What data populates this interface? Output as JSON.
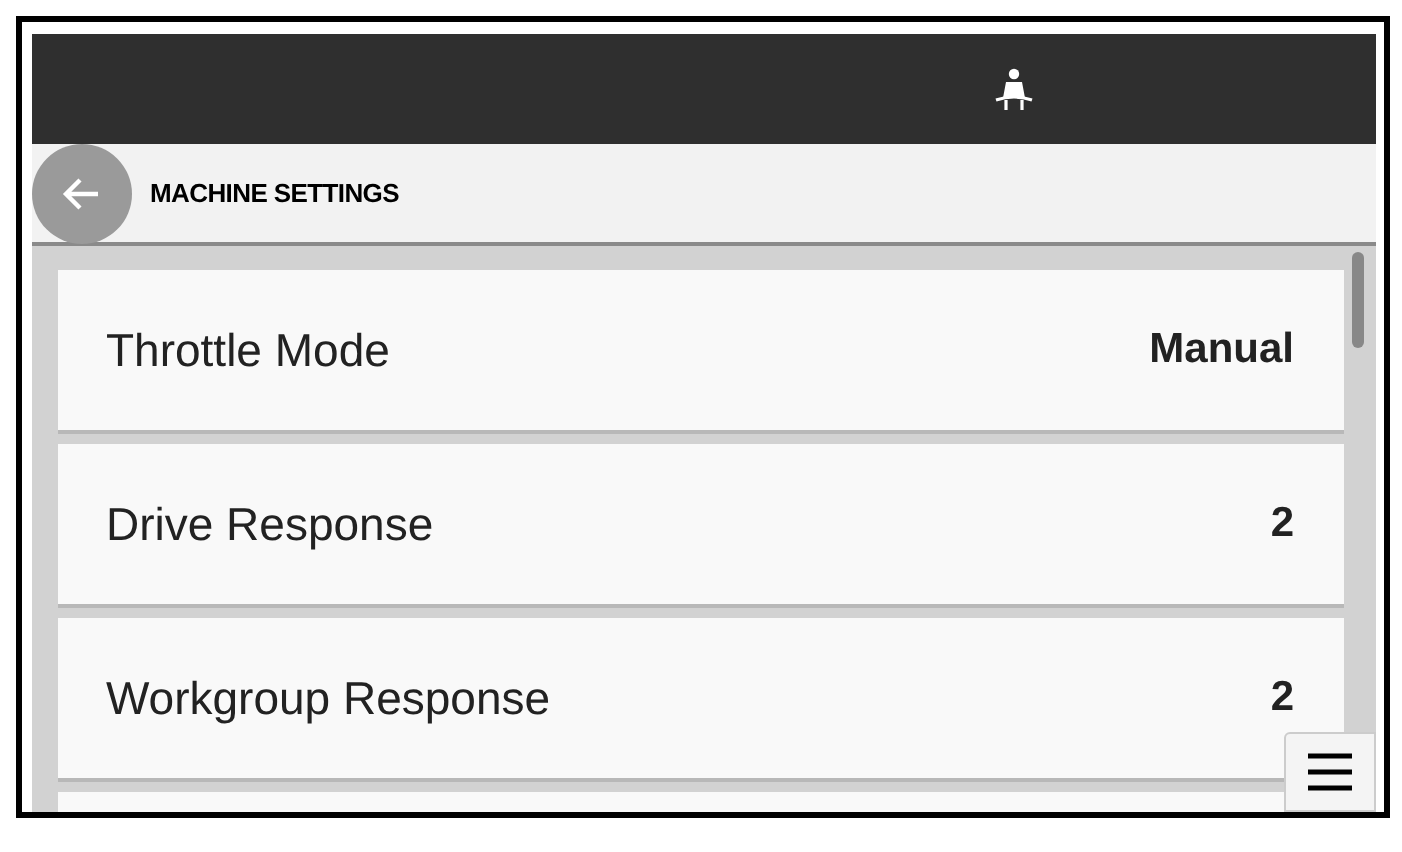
{
  "header": {
    "title": "MACHINE SETTINGS"
  },
  "settings": [
    {
      "label": "Throttle Mode",
      "value": "Manual"
    },
    {
      "label": "Drive Response",
      "value": "2"
    },
    {
      "label": "Workgroup Response",
      "value": "2"
    }
  ]
}
